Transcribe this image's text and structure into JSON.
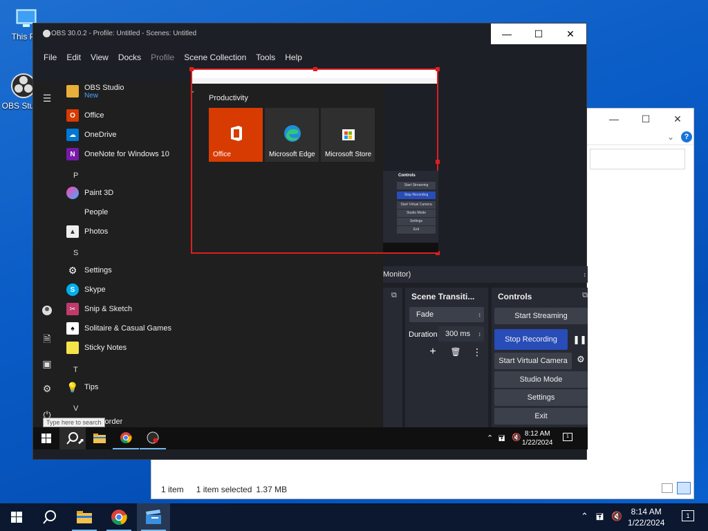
{
  "desktop": {
    "icons": [
      {
        "label": "This PC"
      },
      {
        "label": "OBS Studio"
      }
    ]
  },
  "explorer": {
    "status_count": "1 item",
    "status_selected": "1 item selected",
    "status_size": "1.37 MB",
    "help_glyph": "?"
  },
  "obs": {
    "title": "OBS 30.0.2 - Profile: Untitled - Scenes: Untitled",
    "menu": [
      "File",
      "Edit",
      "View",
      "Docks",
      "Profile",
      "Scene Collection",
      "Tools",
      "Help"
    ],
    "start_menu": {
      "items": [
        {
          "label": "OBS Studio",
          "sub": "New"
        },
        {
          "label": "Office"
        },
        {
          "label": "OneDrive"
        },
        {
          "label": "OneNote for Windows 10"
        },
        {
          "label": "Paint 3D"
        },
        {
          "label": "People"
        },
        {
          "label": "Photos"
        },
        {
          "label": "Settings"
        },
        {
          "label": "Skype"
        },
        {
          "label": "Snip & Sketch"
        },
        {
          "label": "Solitaire & Casual Games"
        },
        {
          "label": "Sticky Notes"
        },
        {
          "label": "Tips"
        },
        {
          "label": "Recorder"
        }
      ],
      "letters": [
        "P",
        "S",
        "T",
        "V"
      ],
      "tiles_title": "Productivity",
      "tiles": [
        {
          "label": "Office"
        },
        {
          "label": "Microsoft Edge"
        },
        {
          "label": "Microsoft Store"
        }
      ],
      "search_tooltip": "Type here to search"
    },
    "monitor_label": "Monitor)",
    "scene_transitions": {
      "title": "Scene Transiti...",
      "transition": "Fade",
      "duration_label": "Duration",
      "duration_value": "300 ms"
    },
    "controls": {
      "title": "Controls",
      "start_streaming": "Start Streaming",
      "stop_recording": "Stop Recording",
      "start_virtual_camera": "Start Virtual Camera",
      "studio_mode": "Studio Mode",
      "settings": "Settings",
      "exit": "Exit"
    },
    "mini_controls": {
      "title": "Controls",
      "items": [
        "Start Streaming",
        "Stop Recording",
        "Start Virtual Camera",
        "Studio Mode",
        "Settings",
        "Exit"
      ]
    },
    "inner_taskbar": {
      "time": "8:12 AM",
      "date": "1/22/2024",
      "notification_count": "1"
    }
  },
  "taskbar": {
    "time": "8:14 AM",
    "date": "1/22/2024",
    "notification_count": "1"
  },
  "colors": {
    "desktop_blue": "#0a5cc6",
    "obs_bg": "#1d1f26",
    "obs_panel": "#272a33",
    "obs_button": "#3c404b",
    "obs_active_blue": "#284cb8",
    "capture_red": "#e01e1e",
    "office_tile": "#d83b01"
  }
}
